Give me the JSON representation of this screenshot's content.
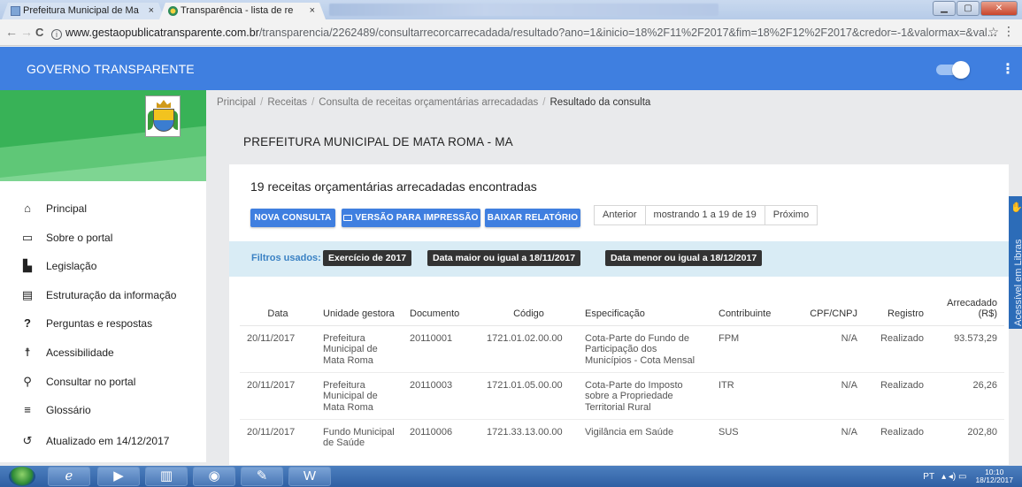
{
  "browser": {
    "tabs": [
      {
        "title": "Prefeitura Municipal de Ma",
        "active": false
      },
      {
        "title": "Transparência - lista de re",
        "active": true
      }
    ],
    "url_domain": "www.gestaopublicatransparente.com.br",
    "url_path": "/transparencia/2262489/consultarrecorcarrecadada/resultado?ano=1&inicio=18%2F11%2F2017&fim=18%2F12%2F2017&credor=-1&valormax=&val...",
    "close_glyph": "×",
    "back_glyph": "←",
    "forward_glyph": "→",
    "reload_glyph": "C",
    "star_glyph": "☆",
    "menu_glyph": "⋮",
    "info_glyph": "i"
  },
  "appbar": {
    "brand": "GOVERNO TRANSPARENTE",
    "color": "#3f7fe0",
    "kebab_glyph": "⋮"
  },
  "sidebar": {
    "items": [
      {
        "label": "Principal",
        "icon": "home-icon",
        "glyph": "⌂"
      },
      {
        "label": "Sobre o portal",
        "icon": "folder-icon",
        "glyph": "▭"
      },
      {
        "label": "Legislação",
        "icon": "document-icon",
        "glyph": "▙"
      },
      {
        "label": "Estruturação da informação",
        "icon": "structure-icon",
        "glyph": "▤"
      },
      {
        "label": "Perguntas e respostas",
        "icon": "help-icon",
        "glyph": "?"
      },
      {
        "label": "Acessibilidade",
        "icon": "accessibility-icon",
        "glyph": "☨"
      },
      {
        "label": "Consultar no portal",
        "icon": "search-icon",
        "glyph": "⚲"
      },
      {
        "label": "Glossário",
        "icon": "list-icon",
        "glyph": "≡"
      },
      {
        "label": "Atualizado em 14/12/2017",
        "icon": "history-icon",
        "glyph": "↺"
      }
    ]
  },
  "breadcrumb": {
    "items": [
      "Principal",
      "Receitas",
      "Consulta de receitas orçamentárias arrecadadas"
    ],
    "current": "Resultado da consulta",
    "separator": "/"
  },
  "page_title": "PREFEITURA MUNICIPAL DE MATA ROMA - MA",
  "results": {
    "count_text": "19 receitas orçamentárias arrecadadas encontradas",
    "buttons": {
      "new_query": "NOVA CONSULTA",
      "print_version": "VERSÃO PARA IMPRESSÃO",
      "download_report": "BAIXAR RELATÓRIO"
    },
    "pager": {
      "previous": "Anterior",
      "status": "mostrando 1 a 19 de 19",
      "next": "Próximo"
    }
  },
  "filters": {
    "label": "Filtros usados:",
    "chips": [
      "Exercício de 2017",
      "Data maior ou igual a 18/11/2017",
      "Data menor ou igual a 18/12/2017"
    ]
  },
  "table": {
    "headers": [
      "Data",
      "Unidade gestora",
      "Documento",
      "Código",
      "Especificação",
      "Contribuinte",
      "CPF/CNPJ",
      "Registro",
      "Arrecadado (R$)"
    ],
    "rows": [
      [
        "20/11/2017",
        "Prefeitura Municipal de Mata Roma",
        "20110001",
        "1721.01.02.00.00",
        "Cota-Parte do Fundo de Participação dos Municípios - Cota Mensal",
        "FPM",
        "N/A",
        "Realizado",
        "93.573,29"
      ],
      [
        "20/11/2017",
        "Prefeitura Municipal de Mata Roma",
        "20110003",
        "1721.01.05.00.00",
        "Cota-Parte do Imposto sobre a Propriedade Territorial Rural",
        "ITR",
        "N/A",
        "Realizado",
        "26,26"
      ],
      [
        "20/11/2017",
        "Fundo Municipal de Saúde",
        "20110006",
        "1721.33.13.00.00",
        "Vigilância em Saúde",
        "SUS",
        "N/A",
        "Realizado",
        "202,80"
      ]
    ]
  },
  "accessibility": {
    "label": "Acessível em Libras"
  },
  "taskbar": {
    "language": "PT",
    "time": "10:10",
    "date": "18/12/2017",
    "tray_glyphs": "▴ ◂) ▭"
  }
}
